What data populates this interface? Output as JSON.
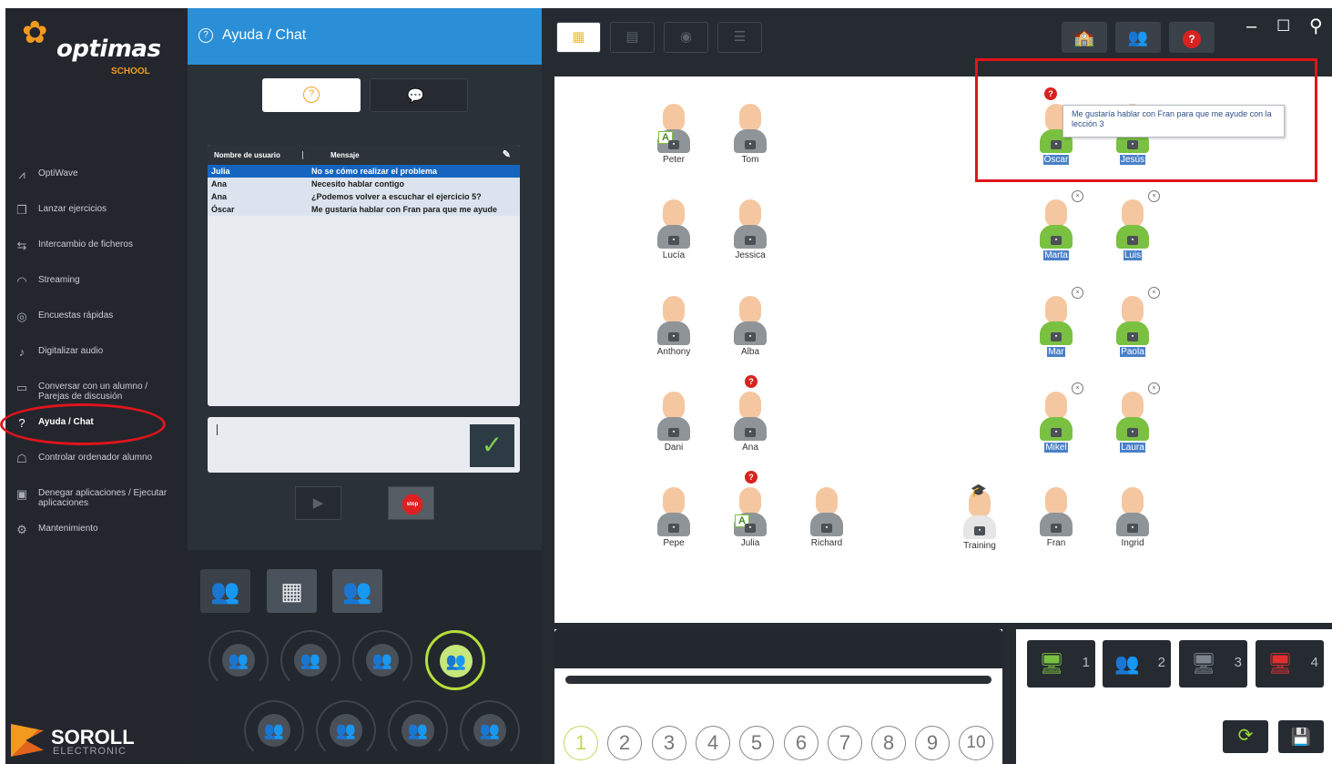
{
  "logo": {
    "word": "optimas",
    "sub": "SCHOOL",
    "flower": "✿"
  },
  "brand": {
    "word": "SOROLL",
    "sub": "ELECTRONIC"
  },
  "sidebar": {
    "items": [
      {
        "label": "OptiWave",
        "icon": "⩘"
      },
      {
        "label": "Lanzar ejercicios",
        "icon": "❐"
      },
      {
        "label": "Intercambio de ficheros",
        "icon": "⇆"
      },
      {
        "label": "Streaming",
        "icon": "◠"
      },
      {
        "label": "Encuestas rápidas",
        "icon": "◎"
      },
      {
        "label": "Digitalizar audio",
        "icon": "♪"
      },
      {
        "label": "Conversar con un alumno / Parejas de discusión",
        "icon": "▭"
      },
      {
        "label": "Ayuda / Chat",
        "icon": "?"
      },
      {
        "label": "Controlar ordenador alumno",
        "icon": "☖"
      },
      {
        "label": "Denegar aplicaciones / Ejecutar aplicaciones",
        "icon": "▣"
      },
      {
        "label": "Mantenimiento",
        "icon": "⚙"
      }
    ]
  },
  "panel": {
    "title": "Ayuda / Chat",
    "q_icon": "?",
    "toggle_help_icon": "?",
    "toggle_chat_icon": "💬",
    "table": {
      "col_user": "Nombre de usuario",
      "col_message": "Mensaje",
      "edit_icon": "✎",
      "rows": [
        {
          "user": "Julia",
          "message": "No se cómo realizar el problema"
        },
        {
          "user": "Ana",
          "message": "Necesito hablar contigo"
        },
        {
          "user": "Ana",
          "message": "¿Podemos volver a escuchar el ejercicio 5?"
        },
        {
          "user": "Óscar",
          "message": "Me gustaría hablar con Fran para que me ayude"
        }
      ]
    },
    "send_icon": "✓",
    "play_icon": "▶",
    "stop_label": "stop"
  },
  "view_buttons": [
    "▦",
    "▤",
    "◉",
    "☰"
  ],
  "toolbar": {
    "icon1": "🏫",
    "icon2": "👥",
    "help_icon": "?",
    "minimize": "–",
    "maximize": "☐",
    "pin": "⚲"
  },
  "students": [
    {
      "name": "Peter",
      "tag": "A"
    },
    {
      "name": "Tom"
    },
    {
      "name": "Lucía"
    },
    {
      "name": "Jessica"
    },
    {
      "name": "Anthony"
    },
    {
      "name": "Alba"
    },
    {
      "name": "Dani"
    },
    {
      "name": "Ana",
      "help": "?"
    },
    {
      "name": "Pepe"
    },
    {
      "name": "Julia",
      "help": "?",
      "tag": "A"
    },
    {
      "name": "Richard"
    },
    {
      "name": "Training"
    },
    {
      "name": "Fran"
    },
    {
      "name": "Ingrid"
    },
    {
      "name": "Óscar",
      "help": "?"
    },
    {
      "name": "Jesús"
    },
    {
      "name": "Marta"
    },
    {
      "name": "Luis"
    },
    {
      "name": "Mar"
    },
    {
      "name": "Paola"
    },
    {
      "name": "Mikel"
    },
    {
      "name": "Laura"
    }
  ],
  "tooltip": "Me gustaría hablar con Fran para que me ayude con la lección 3",
  "pages": [
    "1",
    "2",
    "3",
    "4",
    "5",
    "6",
    "7",
    "8",
    "9",
    "10"
  ],
  "groups": [
    "1",
    "2",
    "3",
    "4"
  ],
  "refresh_icon": "⟳",
  "save_icon": "💾",
  "colors": {
    "accent": "#2a8fd6",
    "help_red": "#d7231f",
    "group_green": "#7ac142",
    "highlight": "#e0141c"
  }
}
